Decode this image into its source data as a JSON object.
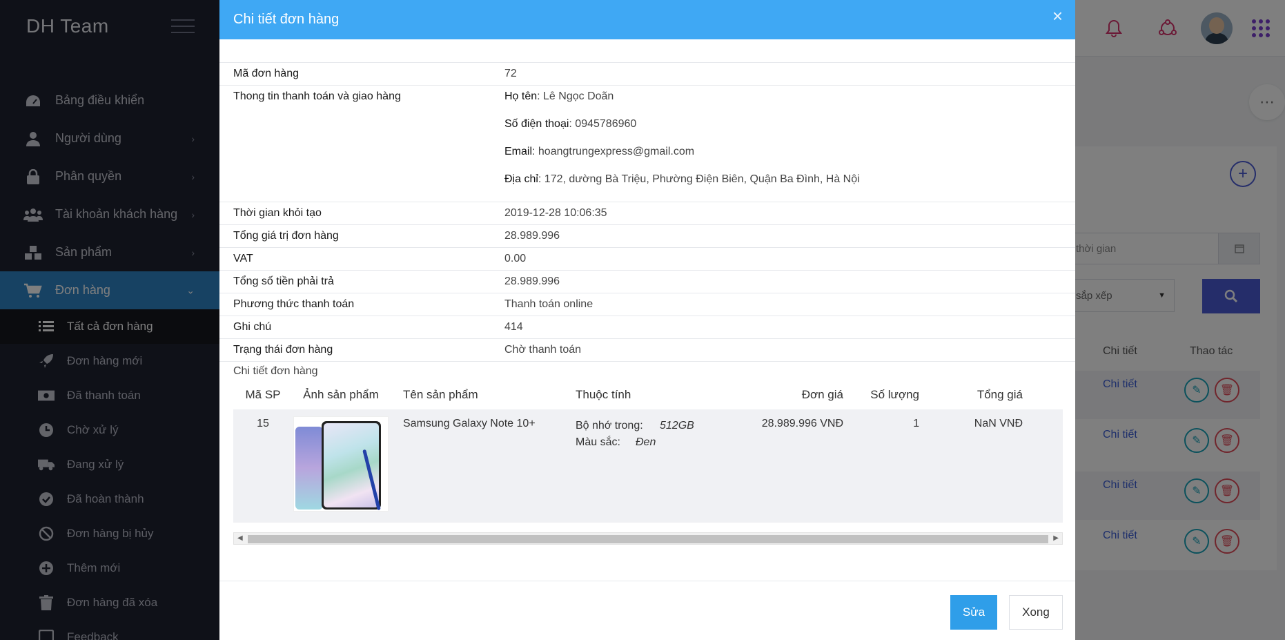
{
  "sidebar": {
    "brand": "DH Team",
    "items": [
      {
        "label": "Bảng điều khiển",
        "icon": "dashboard-icon"
      },
      {
        "label": "Người dùng",
        "icon": "user-icon"
      },
      {
        "label": "Phân quyền",
        "icon": "lock-icon"
      },
      {
        "label": "Tài khoản khách hàng",
        "icon": "users-icon"
      },
      {
        "label": "Sản phẩm",
        "icon": "cubes-icon"
      },
      {
        "label": "Đơn hàng",
        "icon": "cart-icon"
      }
    ],
    "submenu": [
      {
        "label": "Tất cả đơn hàng",
        "icon": "list-icon"
      },
      {
        "label": "Đơn hàng mới",
        "icon": "rocket-icon"
      },
      {
        "label": "Đã thanh toán",
        "icon": "money-icon"
      },
      {
        "label": "Chờ xử lý",
        "icon": "clock-icon"
      },
      {
        "label": "Đang xử lý",
        "icon": "truck-icon"
      },
      {
        "label": "Đã hoàn thành",
        "icon": "check-circle-icon"
      },
      {
        "label": "Đơn hàng bị hủy",
        "icon": "ban-icon"
      },
      {
        "label": "Thêm mới",
        "icon": "plus-circle-icon"
      },
      {
        "label": "Đơn hàng đã xóa",
        "icon": "trash-icon"
      },
      {
        "label": "Feedback",
        "icon": "feedback-icon"
      }
    ]
  },
  "background": {
    "date_placeholder": "thời gian",
    "sort_placeholder": "sắp xếp",
    "col_detail": "Chi tiết",
    "col_action": "Thao tác",
    "row_link": "Chi tiết"
  },
  "modal": {
    "title": "Chi tiết đơn hàng",
    "close": "×",
    "rows": {
      "order_id": {
        "label": "Mã đơn hàng",
        "value": "72"
      },
      "shipping": {
        "label": "Thong tin thanh toán và giao hàng",
        "name_k": "Họ tên",
        "name_v": ": Lê Ngọc Doãn",
        "phone_k": "Số điện thoại",
        "phone_v": ": 0945786960",
        "email_k": "Email",
        "email_v": ": hoangtrungexpress@gmail.com",
        "address_k": "Địa chỉ",
        "address_v": ": 172, dường Bà Triệu, Phường Điện Biên, Quận Ba Đình, Hà Nội"
      },
      "created": {
        "label": "Thời gian khỏi tạo",
        "value": "2019-12-28 10:06:35"
      },
      "total_value": {
        "label": "Tổng giá trị đơn hàng",
        "value": "28.989.996"
      },
      "vat": {
        "label": "VAT",
        "value": "0.00"
      },
      "total_pay": {
        "label": "Tổng số tiền phải trả",
        "value": "28.989.996"
      },
      "payment": {
        "label": "Phương thức thanh toán",
        "value": "Thanh toán online"
      },
      "note": {
        "label": "Ghi chú",
        "value": "414"
      },
      "status": {
        "label": "Trạng thái đơn hàng",
        "value": "Chờ thanh toán"
      }
    },
    "detail_caption": "Chi tiết đơn hàng",
    "product_table": {
      "headers": {
        "id": "Mã SP",
        "image": "Ảnh sản phẩm",
        "name": "Tên sản phẩm",
        "attrs": "Thuộc tính",
        "price": "Đơn giá",
        "qty": "Số lượng",
        "total": "Tổng giá"
      },
      "row": {
        "id": "15",
        "name": "Samsung Galaxy Note 10+",
        "attr1_k": "Bộ nhớ trong:",
        "attr1_v": "512GB",
        "attr2_k": "Màu sắc:",
        "attr2_v": "Đen",
        "price": "28.989.996 VNĐ",
        "qty": "1",
        "total": "NaN VNĐ"
      }
    },
    "buttons": {
      "edit": "Sửa",
      "done": "Xong"
    }
  },
  "colors": {
    "header": "#3fa8f4",
    "sidebar_active": "#2f84c6",
    "primary_btn": "#2f9ee9"
  }
}
